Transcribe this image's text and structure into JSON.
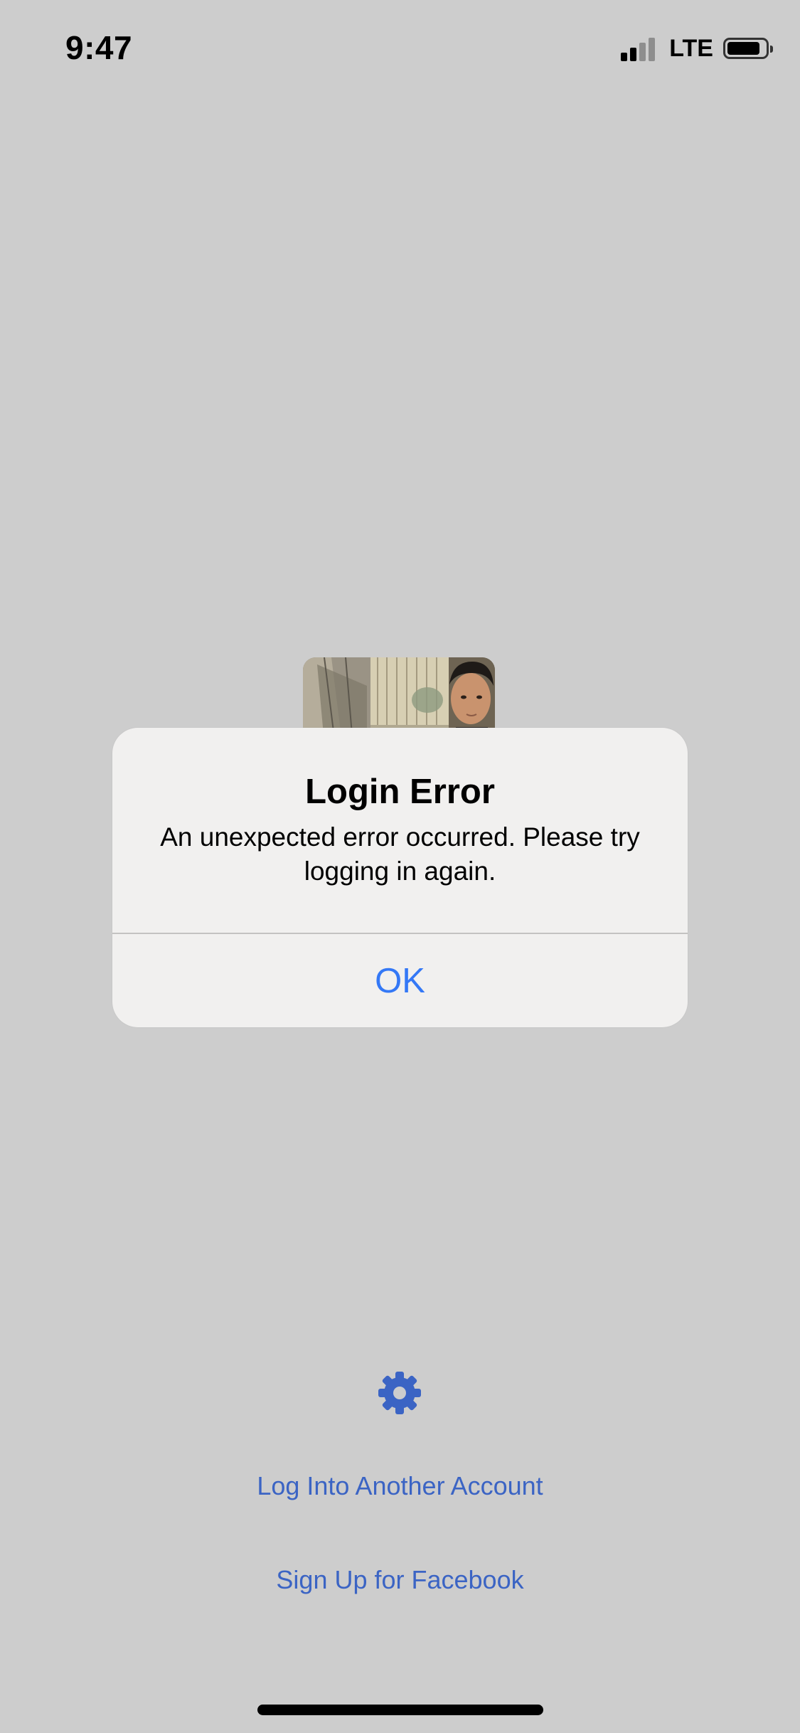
{
  "status_bar": {
    "time": "9:47",
    "network": "LTE"
  },
  "alert": {
    "title": "Login Error",
    "message": "An unexpected error occurred. Please try logging in again.",
    "ok_label": "OK"
  },
  "links": {
    "log_into_another": "Log Into Another Account",
    "sign_up": "Sign Up for Facebook"
  },
  "icons": {
    "settings": "gear-icon",
    "signal": "cellular-signal-icon",
    "battery": "battery-icon"
  },
  "colors": {
    "background": "#cdcdcd",
    "alert_background": "#f1f0ef",
    "alert_button": "#3478f6",
    "link": "#3b64c4"
  }
}
